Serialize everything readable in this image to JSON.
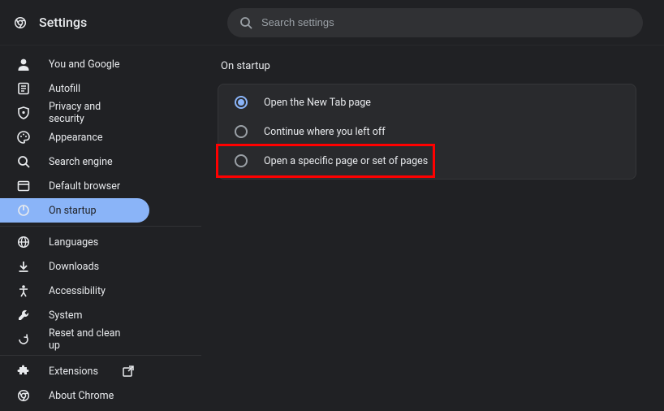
{
  "header": {
    "title": "Settings",
    "search_placeholder": "Search settings"
  },
  "sidebar": {
    "groups": [
      [
        {
          "icon": "person",
          "label": "You and Google",
          "active": false
        },
        {
          "icon": "autofill",
          "label": "Autofill",
          "active": false
        },
        {
          "icon": "shield",
          "label": "Privacy and security",
          "active": false
        },
        {
          "icon": "palette",
          "label": "Appearance",
          "active": false
        },
        {
          "icon": "search",
          "label": "Search engine",
          "active": false
        },
        {
          "icon": "browser",
          "label": "Default browser",
          "active": false
        },
        {
          "icon": "power",
          "label": "On startup",
          "active": true
        }
      ],
      [
        {
          "icon": "globe",
          "label": "Languages",
          "active": false
        },
        {
          "icon": "download",
          "label": "Downloads",
          "active": false
        },
        {
          "icon": "accessibility",
          "label": "Accessibility",
          "active": false
        },
        {
          "icon": "wrench",
          "label": "System",
          "active": false
        },
        {
          "icon": "reset",
          "label": "Reset and clean up",
          "active": false
        }
      ],
      [
        {
          "icon": "extension",
          "label": "Extensions",
          "active": false,
          "external": true
        },
        {
          "icon": "chrome",
          "label": "About Chrome",
          "active": false
        }
      ]
    ]
  },
  "main": {
    "section_title": "On startup",
    "options": [
      {
        "label": "Open the New Tab page",
        "selected": true
      },
      {
        "label": "Continue where you left off",
        "selected": false
      },
      {
        "label": "Open a specific page or set of pages",
        "selected": false,
        "highlighted": true
      }
    ]
  }
}
